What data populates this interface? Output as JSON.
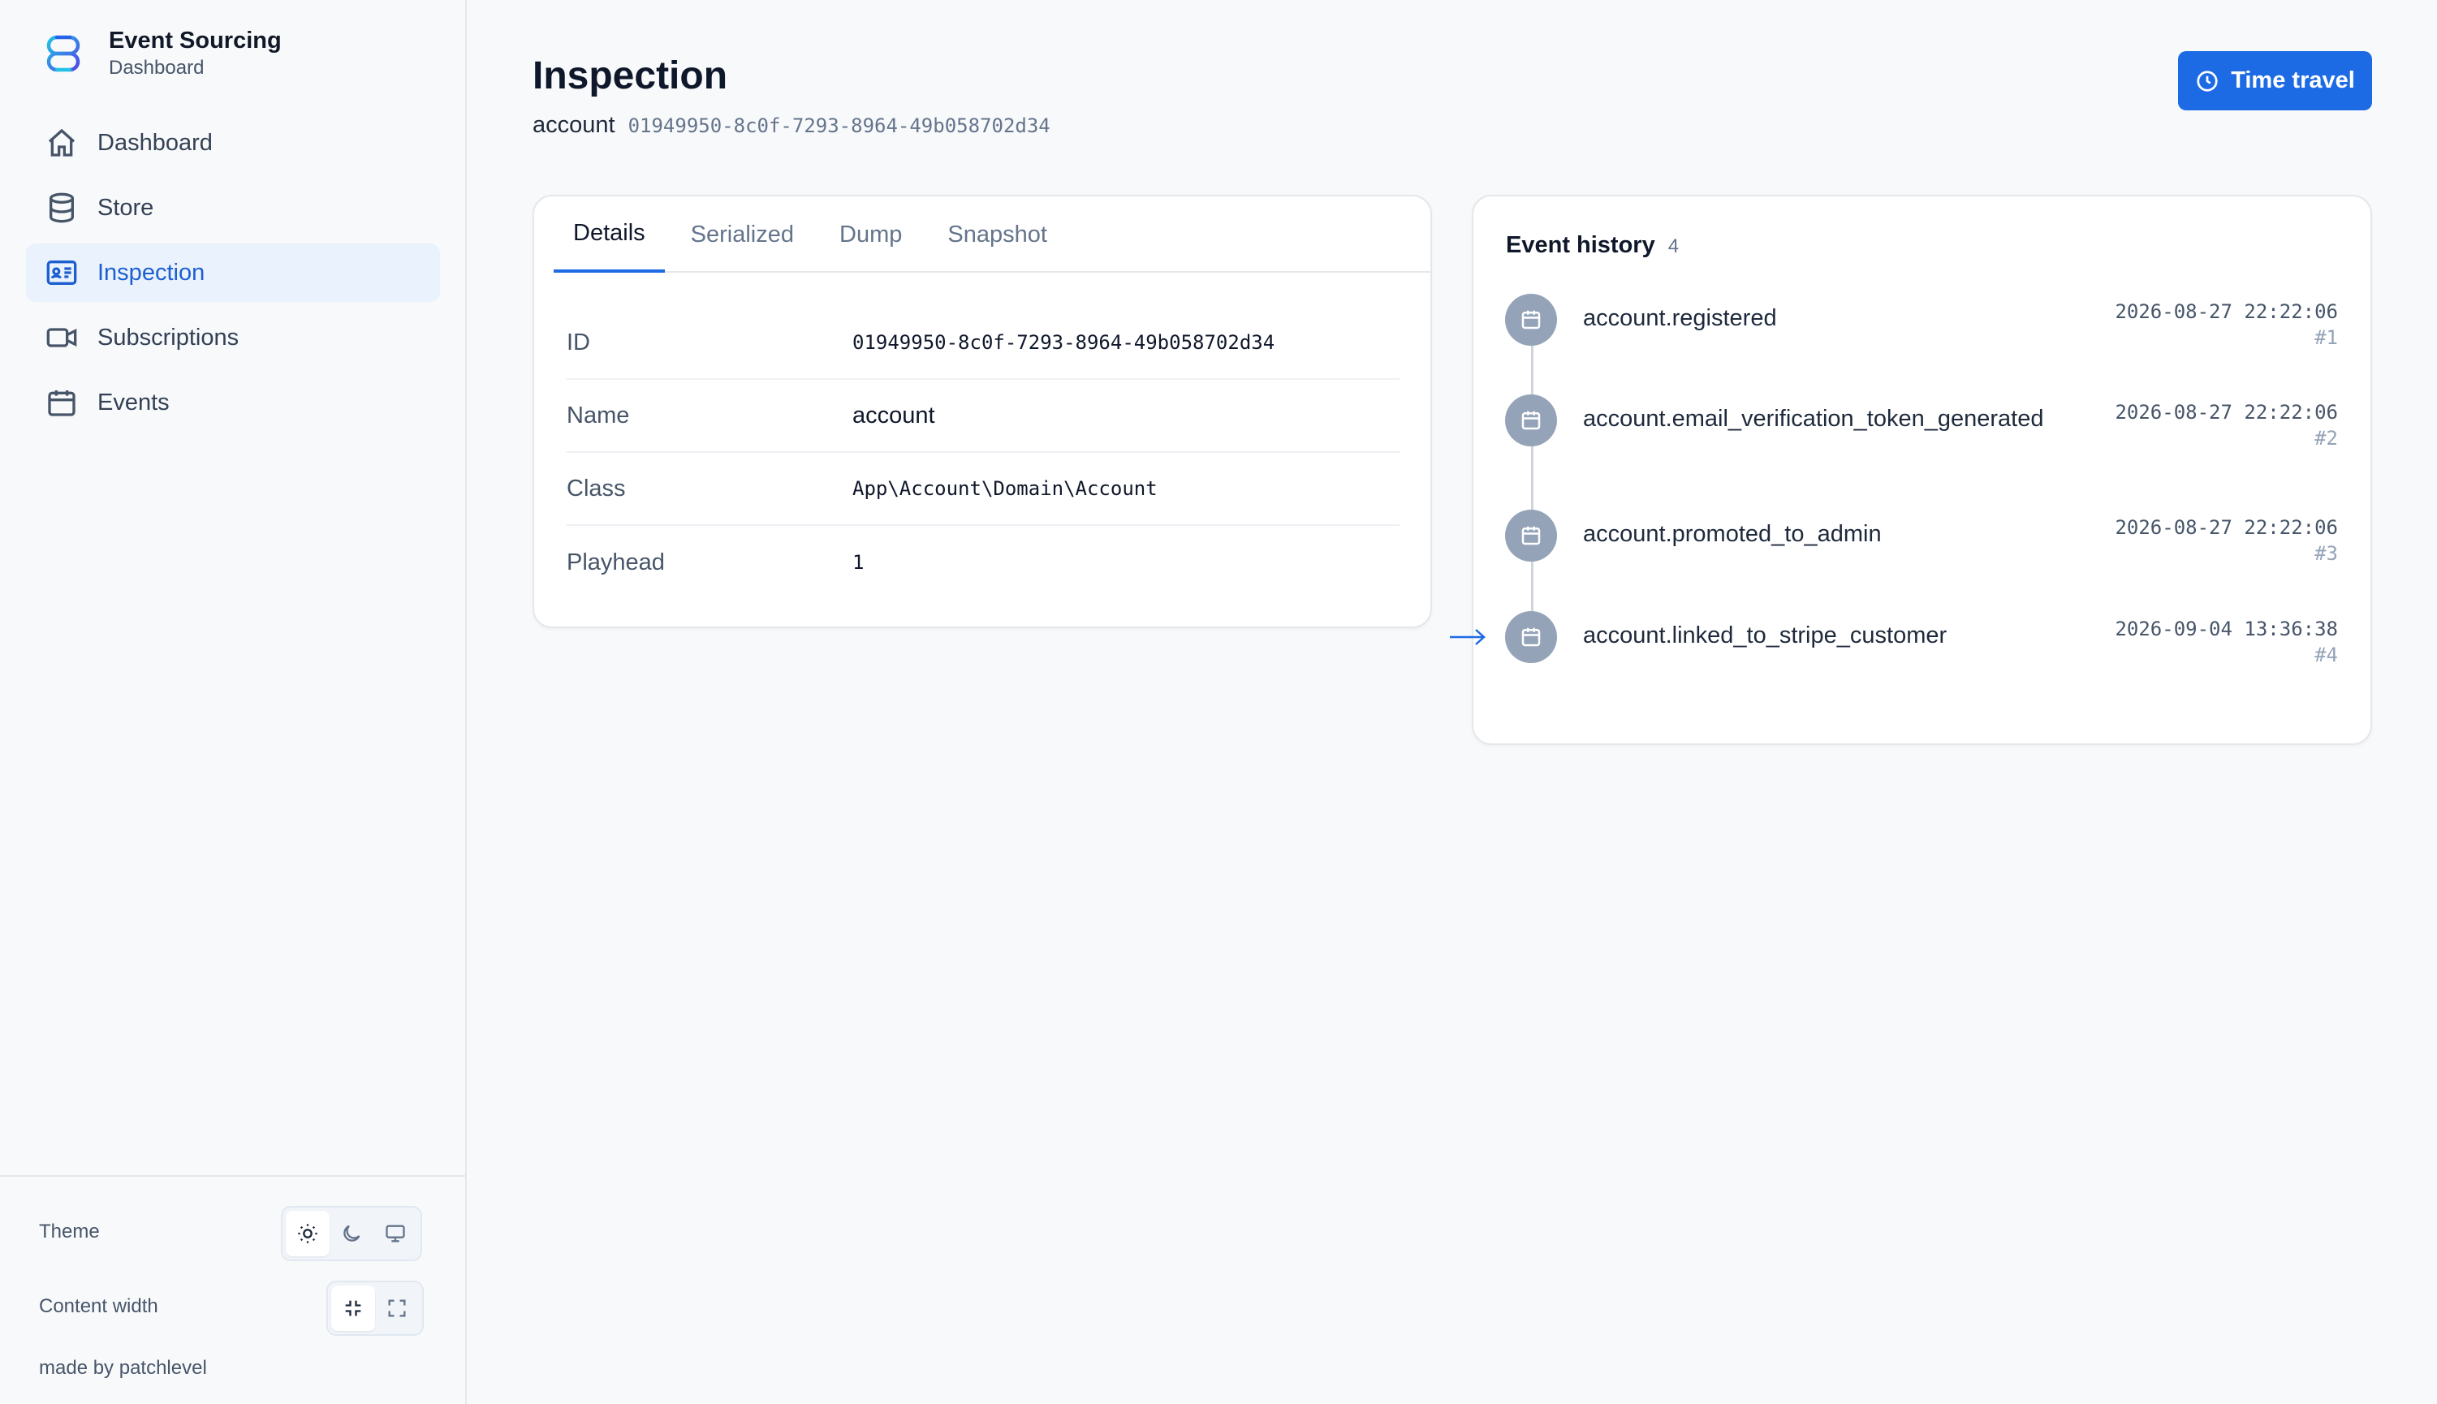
{
  "brand": {
    "title": "Event Sourcing",
    "subtitle": "Dashboard",
    "logo_icon": "knot-logo-icon"
  },
  "sidebar": {
    "items": [
      {
        "label": "Dashboard",
        "icon": "home-icon",
        "active": false
      },
      {
        "label": "Store",
        "icon": "database-icon",
        "active": false
      },
      {
        "label": "Inspection",
        "icon": "id-card-icon",
        "active": true
      },
      {
        "label": "Subscriptions",
        "icon": "video-camera-icon",
        "active": false
      },
      {
        "label": "Events",
        "icon": "calendar-icon",
        "active": false
      }
    ],
    "footer": {
      "theme_label": "Theme",
      "content_width_label": "Content width",
      "credit": "made by patchlevel"
    }
  },
  "header": {
    "title": "Inspection",
    "aggregate_name": "account",
    "aggregate_id": "01949950-8c0f-7293-8964-49b058702d34",
    "time_travel_label": "Time travel"
  },
  "tabs": [
    "Details",
    "Serialized",
    "Dump",
    "Snapshot"
  ],
  "active_tab": "Details",
  "details": [
    {
      "label": "ID",
      "value": "01949950-8c0f-7293-8964-49b058702d34"
    },
    {
      "label": "Name",
      "value": "account"
    },
    {
      "label": "Class",
      "value": "App\\Account\\Domain\\Account"
    },
    {
      "label": "Playhead",
      "value": "1"
    }
  ],
  "history": {
    "title": "Event history",
    "count": "4",
    "events": [
      {
        "name": "account.registered",
        "time": "2026-08-27 22:22:06",
        "number": "#1"
      },
      {
        "name": "account.email_verification_token_generated",
        "time": "2026-08-27 22:22:06",
        "number": "#2"
      },
      {
        "name": "account.promoted_to_admin",
        "time": "2026-08-27 22:22:06",
        "number": "#3"
      },
      {
        "name": "account.linked_to_stripe_customer",
        "time": "2026-09-04 13:36:38",
        "number": "#4"
      }
    ]
  },
  "colors": {
    "accent": "#1d6ae5",
    "active_nav_bg": "#eaf2fd",
    "dot": "#94a3b8"
  }
}
